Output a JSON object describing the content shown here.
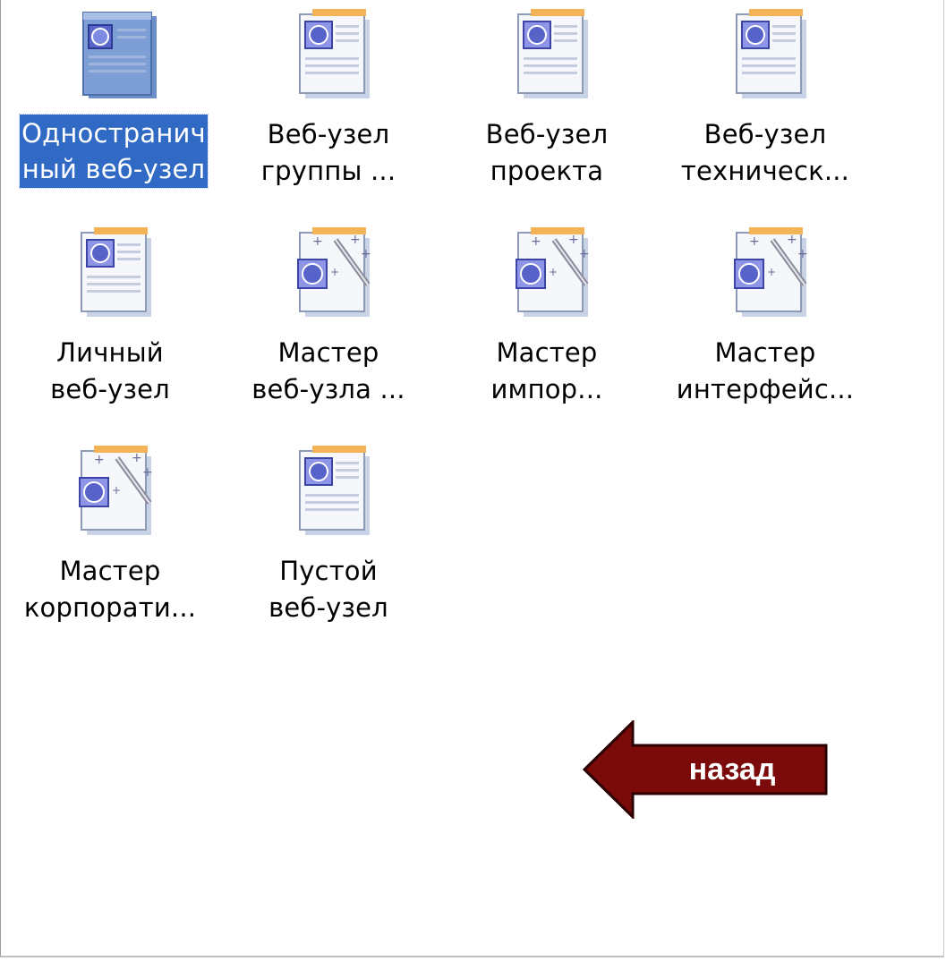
{
  "items": [
    {
      "line1": "Одностранич",
      "line2": "ный веб-узел",
      "icon": "web-page-icon",
      "selected": true
    },
    {
      "line1": "Веб-узел",
      "line2": "группы ...",
      "icon": "web-page-icon",
      "selected": false
    },
    {
      "line1": "Веб-узел",
      "line2": "проекта",
      "icon": "web-page-icon",
      "selected": false
    },
    {
      "line1": "Веб-узел",
      "line2": "техническ...",
      "icon": "web-page-icon",
      "selected": false
    },
    {
      "line1": "Личный",
      "line2": "веб-узел",
      "icon": "web-page-icon",
      "selected": false
    },
    {
      "line1": "Мастер",
      "line2": "веб-узла ...",
      "icon": "wizard-icon",
      "selected": false
    },
    {
      "line1": "Мастер",
      "line2": "импор...",
      "icon": "wizard-icon",
      "selected": false
    },
    {
      "line1": "Мастер",
      "line2": "интерфейс...",
      "icon": "wizard-icon",
      "selected": false
    },
    {
      "line1": "Мастер",
      "line2": "корпорати...",
      "icon": "wizard-icon",
      "selected": false
    },
    {
      "line1": "Пустой",
      "line2": "веб-узел",
      "icon": "web-page-icon",
      "selected": false
    }
  ],
  "back_button": {
    "label": "назад",
    "icon": "left-arrow-icon",
    "color": "#7b0a0a"
  },
  "colors": {
    "selection": "#316ac5",
    "background": "#ffffff"
  }
}
